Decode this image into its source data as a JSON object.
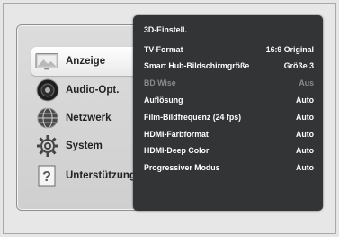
{
  "sidebar": {
    "items": [
      {
        "label": "Anzeige",
        "icon": "display-icon",
        "active": true
      },
      {
        "label": "Audio-Opt.",
        "icon": "speaker-icon",
        "active": false
      },
      {
        "label": "Netzwerk",
        "icon": "globe-network-icon",
        "active": false
      },
      {
        "label": "System",
        "icon": "gear-icon",
        "active": false
      },
      {
        "label": "Unterstützung",
        "icon": "help-question-icon",
        "active": false
      }
    ]
  },
  "menu": {
    "rows": [
      {
        "label": "3D-Einstell.",
        "value": "",
        "disabled": false
      },
      {
        "label": "TV-Format",
        "value": "16:9 Original",
        "disabled": false
      },
      {
        "label": "Smart Hub-Bildschirmgröße",
        "value": "Größe 3",
        "disabled": false
      },
      {
        "label": "BD Wise",
        "value": "Aus",
        "disabled": true
      },
      {
        "label": "Auflösung",
        "value": "Auto",
        "disabled": false
      },
      {
        "label": "Film-Bildfrequenz (24 fps)",
        "value": "Auto",
        "disabled": false
      },
      {
        "label": "HDMI-Farbformat",
        "value": "Auto",
        "disabled": false
      },
      {
        "label": "HDMI-Deep Color",
        "value": "Auto",
        "disabled": false
      },
      {
        "label": "Progressiver Modus",
        "value": "Auto",
        "disabled": false
      }
    ]
  },
  "colors": {
    "menu_background": "#333435",
    "panel_background": "#d6d6d6",
    "disabled_text": "#8a8a8a"
  }
}
